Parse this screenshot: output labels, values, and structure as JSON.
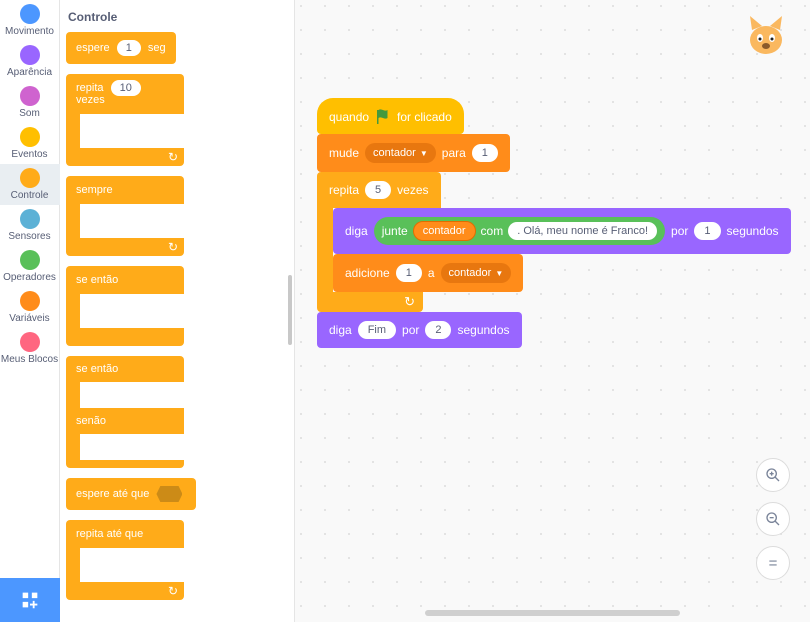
{
  "categories": [
    {
      "id": "motion",
      "label": "Movimento",
      "color": "#4c97ff"
    },
    {
      "id": "looks",
      "label": "Aparência",
      "color": "#9966ff"
    },
    {
      "id": "sound",
      "label": "Som",
      "color": "#cf63cf"
    },
    {
      "id": "events",
      "label": "Eventos",
      "color": "#ffbf00"
    },
    {
      "id": "control",
      "label": "Controle",
      "color": "#ffab19"
    },
    {
      "id": "sensing",
      "label": "Sensores",
      "color": "#5cb1d6"
    },
    {
      "id": "operators",
      "label": "Operadores",
      "color": "#59c059"
    },
    {
      "id": "variables",
      "label": "Variáveis",
      "color": "#ff8c1a"
    },
    {
      "id": "myblocks",
      "label": "Meus Blocos",
      "color": "#ff6680"
    }
  ],
  "active_category": "control",
  "palette": {
    "heading": "Controle",
    "blocks": {
      "wait": {
        "pre": "espere",
        "arg": "1",
        "post": "seg"
      },
      "repeat": {
        "pre": "repita",
        "arg": "10",
        "post": "vezes"
      },
      "forever": {
        "pre": "sempre"
      },
      "if": {
        "pre": "se",
        "post": "então"
      },
      "ifelse": {
        "pre": "se",
        "mid": "então",
        "else": "senão"
      },
      "waituntil": {
        "pre": "espere até que"
      },
      "repeatuntil": {
        "pre": "repita até que"
      }
    }
  },
  "colors": {
    "events": "#ffbf00",
    "variables": "#ff8c1a",
    "control": "#ffab19",
    "looks": "#9966ff",
    "operators": "#59c059"
  },
  "script": {
    "hat": {
      "pre": "quando",
      "post": "for clicado"
    },
    "setvar": {
      "pre": "mude",
      "var": "contador",
      "mid": "para",
      "val": "1"
    },
    "repeat": {
      "pre": "repita",
      "val": "5",
      "post": "vezes"
    },
    "say1": {
      "pre": "diga",
      "join": {
        "kw": "junte",
        "a_var": "contador",
        "mid": "com",
        "b_text": ". Olá, meu nome é Franco!"
      },
      "mid": "por",
      "secs": "1",
      "post": "segundos"
    },
    "changevar": {
      "pre": "adicione",
      "val": "1",
      "mid": "a",
      "var": "contador"
    },
    "say2": {
      "pre": "diga",
      "text": "Fim",
      "mid": "por",
      "secs": "2",
      "post": "segundos"
    }
  },
  "controls": {
    "zoom_in": "+",
    "zoom_out": "−",
    "recenter": "="
  },
  "chart_data": null
}
